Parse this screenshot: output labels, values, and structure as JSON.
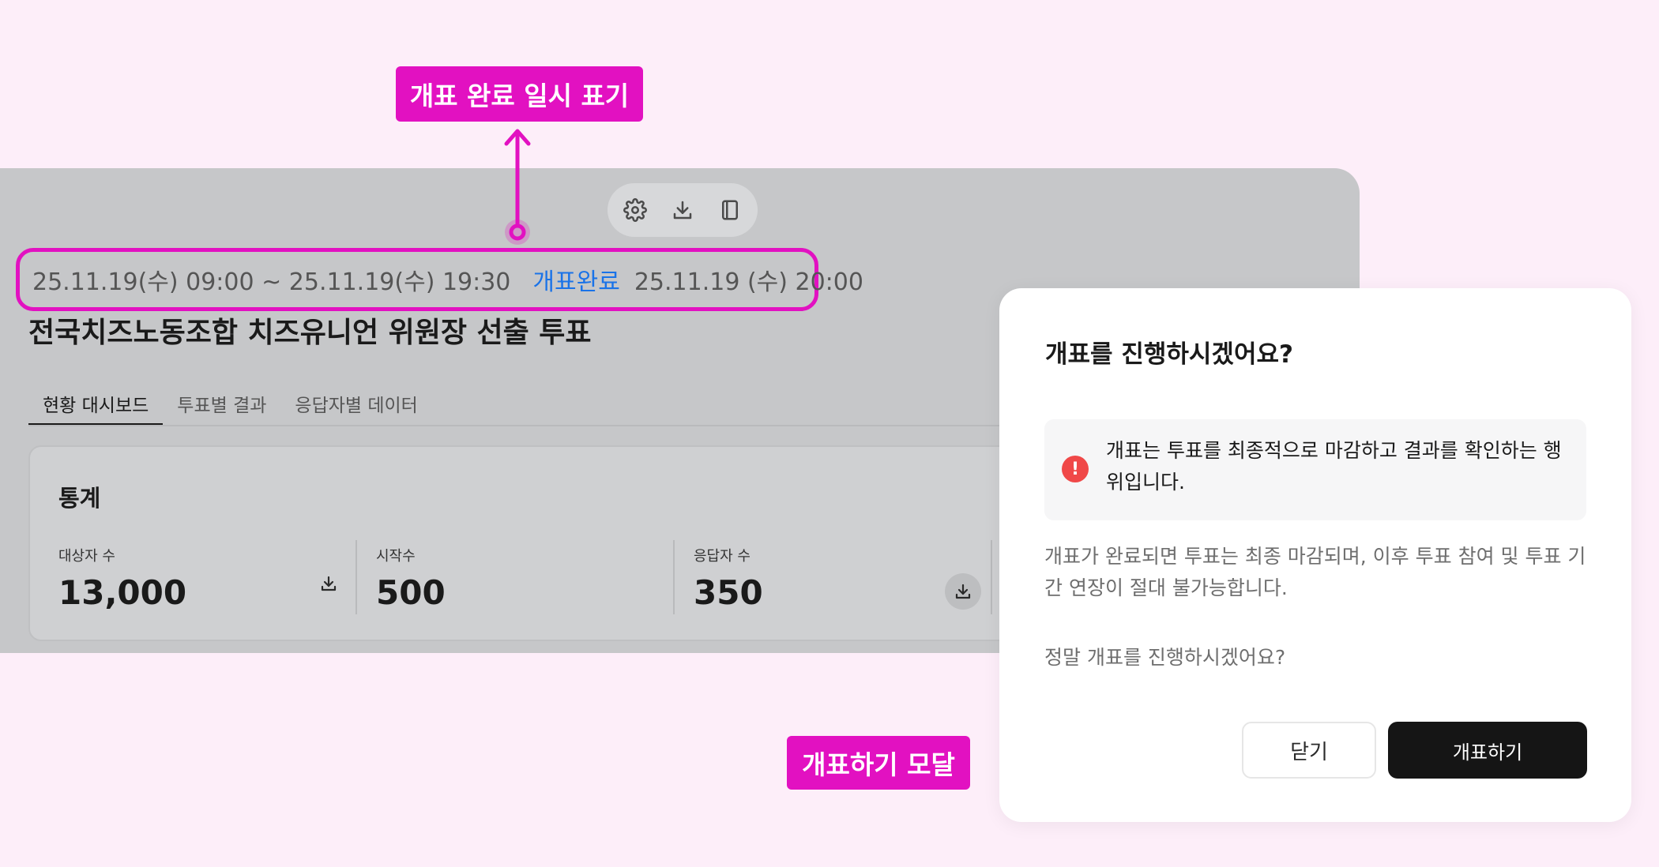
{
  "annotations": {
    "period_callout": "개표 완료 일시 표기",
    "modal_callout": "개표하기 모달"
  },
  "toolbar": {
    "icons": [
      "gear-icon",
      "download-icon",
      "book-icon"
    ]
  },
  "dashboard": {
    "period": {
      "range": "25.11.19(수) 09:00 ~ 25.11.19(수) 19:30",
      "status": "개표완료",
      "completed_at": "25.11.19 (수) 20:00"
    },
    "title": "전국치즈노동조합 치즈유니언 위원장 선출 투표",
    "tabs": [
      {
        "label": "현황 대시보드",
        "active": true
      },
      {
        "label": "투표별 결과",
        "active": false
      },
      {
        "label": "응답자별 데이터",
        "active": false
      }
    ],
    "stats": {
      "title": "통계",
      "items": [
        {
          "label": "대상자 수",
          "value": "13,000"
        },
        {
          "label": "시작수",
          "value": "500"
        },
        {
          "label": "응답자 수",
          "value": "350"
        }
      ]
    }
  },
  "modal": {
    "title": "개표를 진행하시겠어요?",
    "alert": "개표는 투표를 최종적으로 마감하고 결과를 확인하는 행위입니다.",
    "body": "개표가 완료되면 투표는 최종 마감되며, 이후 투표 참여 및 투표 기간 연장이 절대 불가능합니다.",
    "confirm_text": "정말 개표를 진행하시겠어요?",
    "close_label": "닫기",
    "submit_label": "개표하기"
  },
  "colors": {
    "accent": "#e211c1",
    "status_done": "#1a73e8",
    "alert": "#f04848",
    "primary_button": "#151515"
  }
}
